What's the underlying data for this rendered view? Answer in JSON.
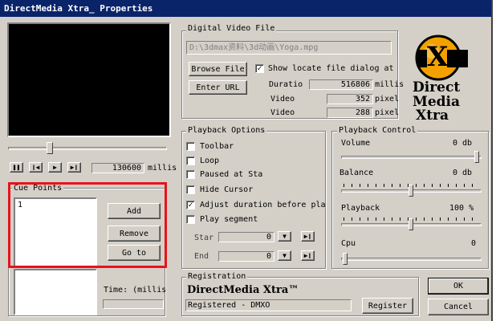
{
  "window": {
    "title": "DirectMedia Xtra_ Properties"
  },
  "video_file": {
    "group_label": "Digital Video File",
    "path": "D:\\3dmax资料\\3d动画\\Yoga.mpg",
    "browse_label": "Browse File",
    "show_locate_label": "Show locate file dialog at",
    "show_locate_checked": true,
    "enter_url_label": "Enter URL",
    "duration_label": "Duratio",
    "duration_value": "516806",
    "duration_unit": "millis",
    "video_width_label": "Video",
    "video_width_value": "352",
    "video_width_unit": "pixel",
    "video_height_label": "Video",
    "video_height_value": "288",
    "video_height_unit": "pixel"
  },
  "transport": {
    "position_value": "130600",
    "position_unit": "millis",
    "position_fraction": 0.25
  },
  "cue_points": {
    "group_label": "Cue Points",
    "items": [
      "1"
    ],
    "add_label": "Add",
    "remove_label": "Remove",
    "goto_label": "Go to",
    "time_label": "Time: (millis"
  },
  "playback_options": {
    "group_label": "Playback Options",
    "toolbar_label": "Toolbar",
    "loop_label": "Loop",
    "paused_label": "Paused at Sta",
    "hide_cursor_label": "Hide Cursor",
    "adjust_label": "Adjust duration before pla",
    "adjust_checked": true,
    "play_segment_label": "Play segment",
    "start_label": "Star",
    "start_value": "0",
    "end_label": "End",
    "end_value": "0"
  },
  "playback_control": {
    "group_label": "Playback Control",
    "volume_label": "Volume",
    "volume_value": "0 db",
    "balance_label": "Balance",
    "balance_value": "0 db",
    "playback_label": "Playback",
    "playback_value": "100 %",
    "cpu_label": "Cpu",
    "cpu_value": "0"
  },
  "registration": {
    "group_label": "Registration",
    "product": "DirectMedia Xtra™",
    "status": "Registered - DMXO",
    "register_label": "Register"
  },
  "logo": {
    "letter": "X",
    "line1": "Direct",
    "line2": "Media",
    "line3": "Xtra"
  },
  "dialog": {
    "ok_label": "OK",
    "cancel_label": "Cancel"
  },
  "colors": {
    "highlight": "#e8121b",
    "title_bar": "#0a246a",
    "logo_orange": "#f2a100"
  }
}
